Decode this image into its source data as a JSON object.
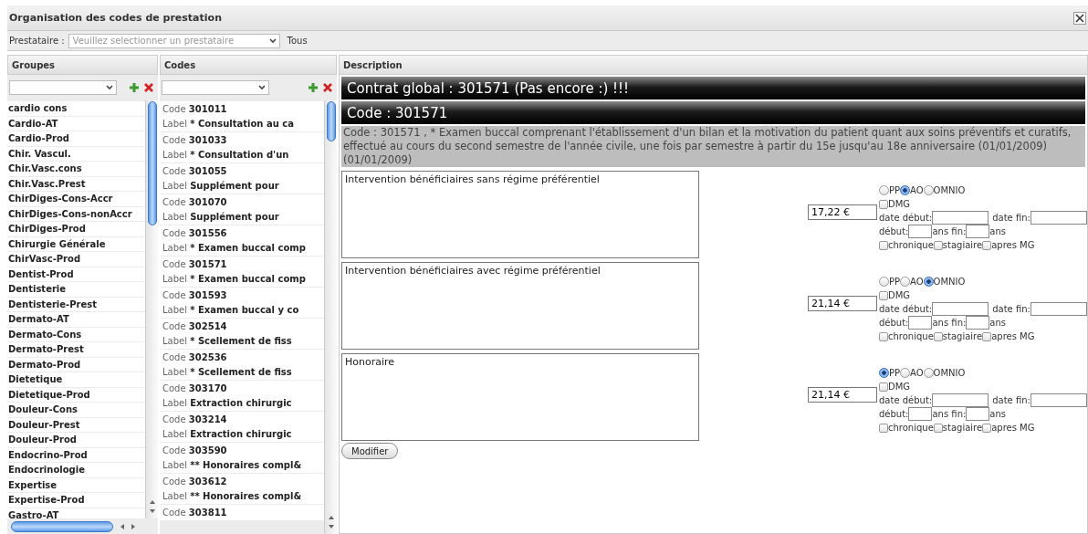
{
  "window": {
    "title": "Organisation des codes de prestation"
  },
  "provider": {
    "label": "Prestataire :",
    "placeholder": "Veuillez selectionner un prestataire",
    "all_label": "Tous"
  },
  "groups": {
    "header": "Groupes",
    "items": [
      "cardio cons",
      "Cardio-AT",
      "Cardio-Prod",
      "Chir. Vascul.",
      "Chir.Vasc.cons",
      "Chir.Vasc.Prest",
      "ChirDiges-Cons-Accr",
      "ChirDiges-Cons-nonAccr",
      "ChirDiges-Prod",
      "Chirurgie Générale",
      "ChirVasc-Prod",
      "Dentist-Prod",
      "Dentisterie",
      "Dentisterie-Prest",
      "Dermato-AT",
      "Dermato-Cons",
      "Dermato-Prest",
      "Dermato-Prod",
      "Dietetique",
      "Dietetique-Prod",
      "Douleur-Cons",
      "Douleur-Prest",
      "Douleur-Prod",
      "Endocrino-Prod",
      "Endocrinologie",
      "Expertise",
      "Expertise-Prod",
      "Gastro-AT"
    ]
  },
  "codes": {
    "header": "Codes",
    "items": [
      {
        "code_label": "Code",
        "code": "301011",
        "label_label": "Label",
        "label": "* Consultation au ca"
      },
      {
        "code_label": "Code",
        "code": "301033",
        "label_label": "Label",
        "label": "* Consultation d'un"
      },
      {
        "code_label": "Code",
        "code": "301055",
        "label_label": "Label",
        "label": "Supplément pour"
      },
      {
        "code_label": "Code",
        "code": "301070",
        "label_label": "Label",
        "label": "Supplément pour"
      },
      {
        "code_label": "Code",
        "code": "301556",
        "label_label": "Label",
        "label": "* Examen buccal comp"
      },
      {
        "code_label": "Code",
        "code": "301571",
        "label_label": "Label",
        "label": "* Examen buccal comp"
      },
      {
        "code_label": "Code",
        "code": "301593",
        "label_label": "Label",
        "label": "* Examen buccal y co"
      },
      {
        "code_label": "Code",
        "code": "302514",
        "label_label": "Label",
        "label": "* Scellement de fiss"
      },
      {
        "code_label": "Code",
        "code": "302536",
        "label_label": "Label",
        "label": "* Scellement de fiss"
      },
      {
        "code_label": "Code",
        "code": "303170",
        "label_label": "Label",
        "label": "Extraction chirurgic"
      },
      {
        "code_label": "Code",
        "code": "303214",
        "label_label": "Label",
        "label": "Extraction chirurgic"
      },
      {
        "code_label": "Code",
        "code": "303590",
        "label_label": "Label",
        "label": "** Honoraires compl&"
      },
      {
        "code_label": "Code",
        "code": "303612",
        "label_label": "Label",
        "label": "** Honoraires compl&"
      },
      {
        "code_label": "Code",
        "code": "303811"
      }
    ]
  },
  "description": {
    "header": "Description",
    "contract_title": "Contrat global : 301571 (Pas encore :) !!!",
    "code_title": "Code : 301571",
    "text": "Code : 301571 , * Examen buccal comprenant l'établissement d'un bilan et la motivation du patient quant aux soins préventifs et curatifs, effectué au cours du second semestre de l'année civile, une fois par semestre à partir du 15e jusqu'au 18e anniversaire (01/01/2009) (01/01/2009)",
    "tariffs": [
      {
        "text": "Intervention bénéficiaires sans régime préférentiel",
        "price": "17,22 €",
        "options": [
          {
            "label": "PP",
            "selected": false
          },
          {
            "label": "AO",
            "selected": true
          },
          {
            "label": "OMNIO",
            "selected": false
          }
        ],
        "dmg": {
          "label": "DMG",
          "checked": false
        },
        "date_start_label": "date début:",
        "date_end_label": "date fin:",
        "age_start_label": "début:",
        "age_end_label": "ans fin:",
        "age_unit_label": "ans",
        "flags": [
          {
            "label": "chronique",
            "checked": false
          },
          {
            "label": "stagiaire",
            "checked": false
          },
          {
            "label": "apres MG",
            "checked": false
          }
        ]
      },
      {
        "text": "Intervention bénéficiaires avec régime préférentiel",
        "price": "21,14 €",
        "options": [
          {
            "label": "PP",
            "selected": false
          },
          {
            "label": "AO",
            "selected": false
          },
          {
            "label": "OMNIO",
            "selected": true
          }
        ],
        "dmg": {
          "label": "DMG",
          "checked": false
        },
        "date_start_label": "date début:",
        "date_end_label": "date fin:",
        "age_start_label": "début:",
        "age_end_label": "ans fin:",
        "age_unit_label": "ans",
        "flags": [
          {
            "label": "chronique",
            "checked": false
          },
          {
            "label": "stagiaire",
            "checked": false
          },
          {
            "label": "apres MG",
            "checked": false
          }
        ]
      },
      {
        "text": "Honoraire",
        "price": "21,14 €",
        "options": [
          {
            "label": "PP",
            "selected": true
          },
          {
            "label": "AO",
            "selected": false
          },
          {
            "label": "OMNIO",
            "selected": false
          }
        ],
        "dmg": {
          "label": "DMG",
          "checked": false
        },
        "date_start_label": "date début:",
        "date_end_label": "date fin:",
        "age_start_label": "début:",
        "age_end_label": "ans fin:",
        "age_unit_label": "ans",
        "flags": [
          {
            "label": "chronique",
            "checked": false
          },
          {
            "label": "stagiaire",
            "checked": false
          },
          {
            "label": "apres MG",
            "checked": false
          }
        ]
      }
    ],
    "button": "Modifier"
  }
}
